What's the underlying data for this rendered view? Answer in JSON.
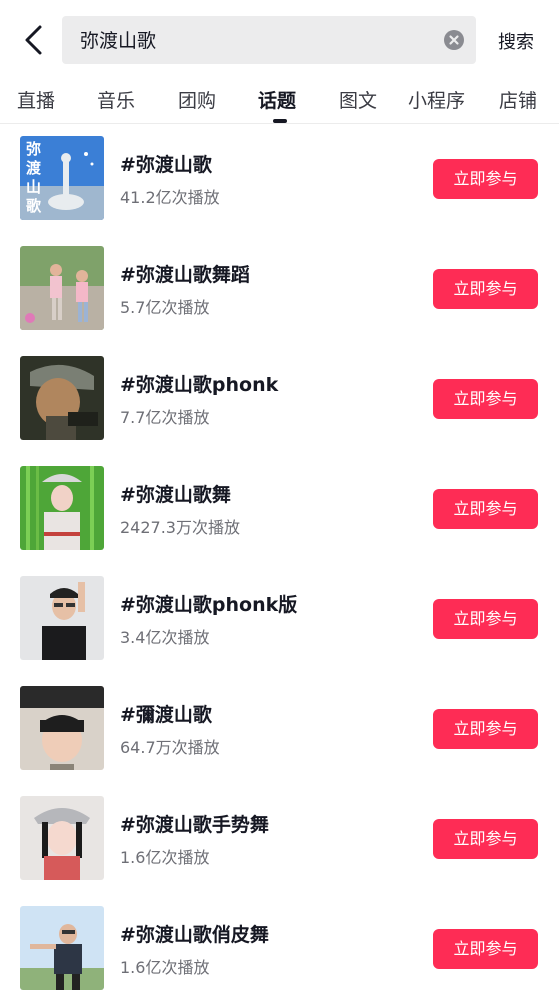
{
  "search": {
    "query": "弥渡山歌",
    "button_label": "搜索"
  },
  "tabs": [
    {
      "label": "直播",
      "active": false
    },
    {
      "label": "音乐",
      "active": false
    },
    {
      "label": "团购",
      "active": false
    },
    {
      "label": "话题",
      "active": true
    },
    {
      "label": "图文",
      "active": false
    },
    {
      "label": "小程序",
      "active": false
    },
    {
      "label": "店铺",
      "active": false
    }
  ],
  "accent_color": "#fe2c55",
  "topics": [
    {
      "title": "#弥渡山歌",
      "plays": "41.2亿次播放",
      "join_label": "立即参与",
      "thumb_text": "弥渡山歌"
    },
    {
      "title": "#弥渡山歌舞蹈",
      "plays": "5.7亿次播放",
      "join_label": "立即参与"
    },
    {
      "title": "#弥渡山歌phonk",
      "plays": "7.7亿次播放",
      "join_label": "立即参与"
    },
    {
      "title": "#弥渡山歌舞",
      "plays": "2427.3万次播放",
      "join_label": "立即参与"
    },
    {
      "title": "#弥渡山歌phonk版",
      "plays": "3.4亿次播放",
      "join_label": "立即参与"
    },
    {
      "title": "#彌渡山歌",
      "plays": "64.7万次播放",
      "join_label": "立即参与"
    },
    {
      "title": "#弥渡山歌手势舞",
      "plays": "1.6亿次播放",
      "join_label": "立即参与"
    },
    {
      "title": "#弥渡山歌俏皮舞",
      "plays": "1.6亿次播放",
      "join_label": "立即参与"
    }
  ],
  "icons": {
    "back": "chevron-left-icon",
    "clear": "clear-circle-icon"
  }
}
